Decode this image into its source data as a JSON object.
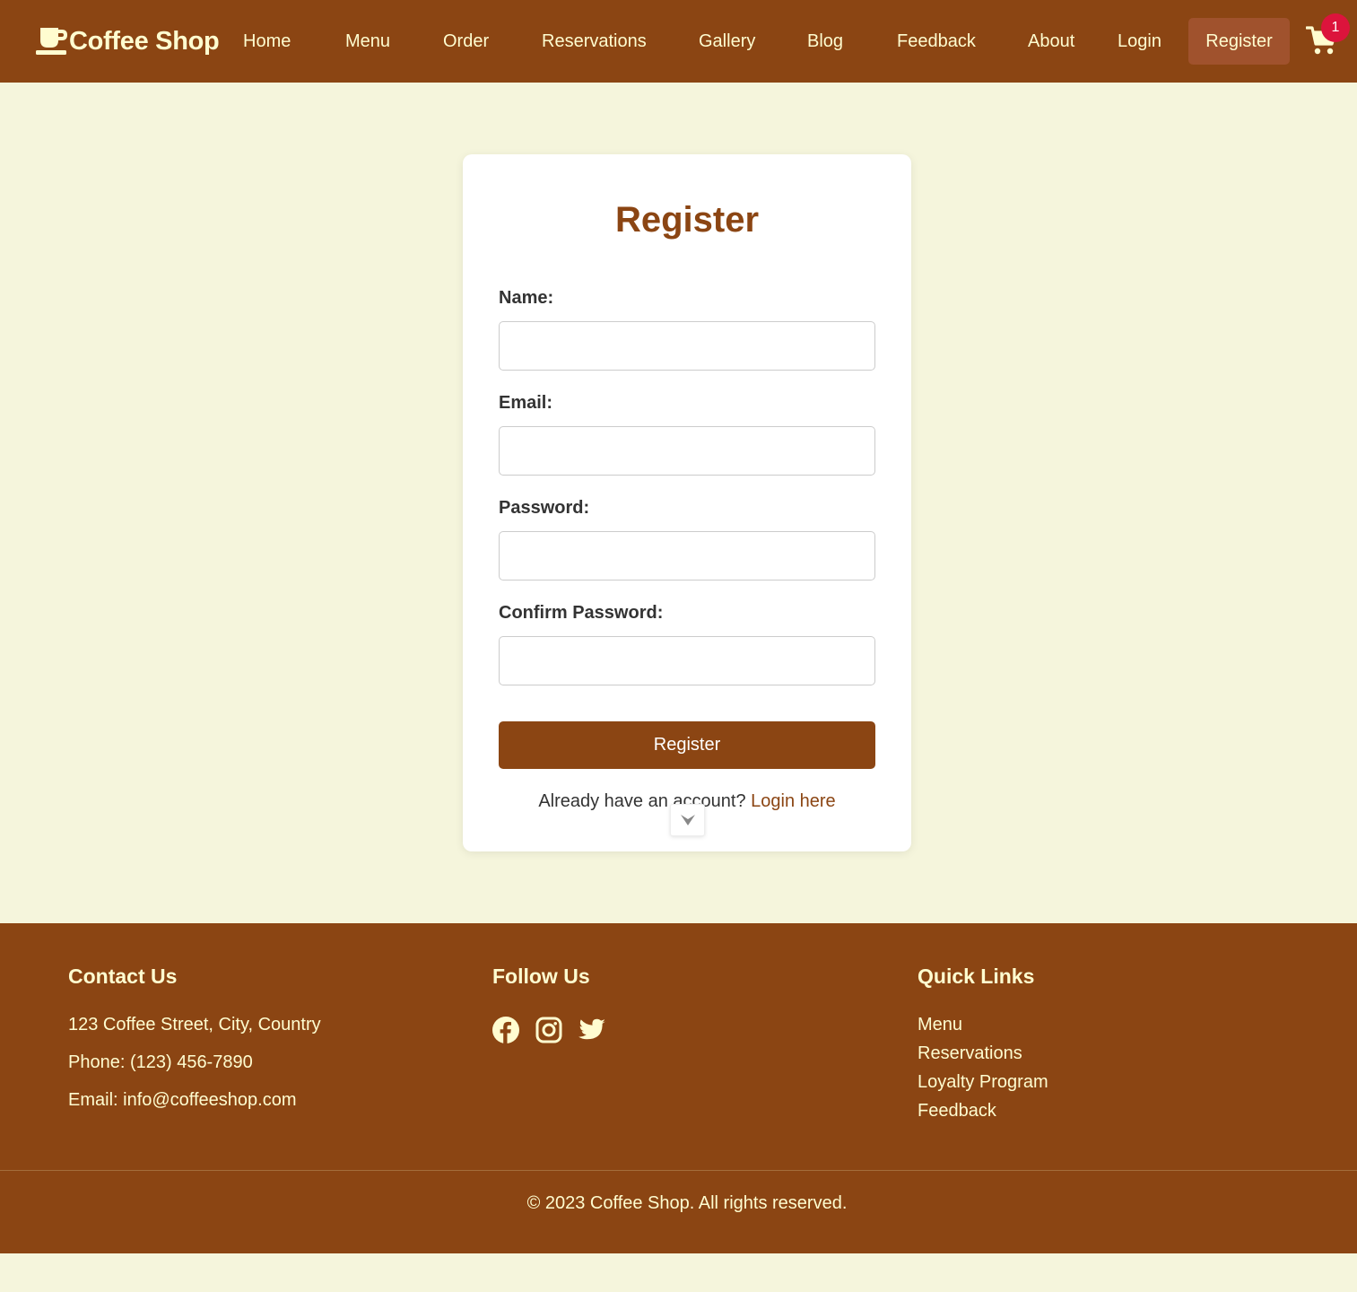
{
  "header": {
    "brand": {
      "icon": "coffee-cup-icon",
      "name": "Coffee Shop"
    },
    "nav": {
      "home": "Home",
      "menu": "Menu",
      "order": "Order",
      "reservations": "Reservations",
      "gallery": "Gallery",
      "blog": "Blog",
      "feedback": "Feedback",
      "about": "About",
      "login": "Login",
      "register": "Register"
    },
    "cart": {
      "icon": "shopping-cart-icon",
      "count": "1"
    }
  },
  "register_form": {
    "title": "Register",
    "fields": {
      "name": {
        "label": "Name:",
        "value": ""
      },
      "email": {
        "label": "Email:",
        "value": ""
      },
      "password": {
        "label": "Password:",
        "value": ""
      },
      "confirm_password": {
        "label": "Confirm Password:",
        "value": ""
      }
    },
    "submit_label": "Register",
    "login_prompt": "Already have an account?",
    "login_link": "Login here"
  },
  "footer": {
    "contact": {
      "heading": "Contact Us",
      "address": "123 Coffee Street, City, Country",
      "phone": "Phone: (123) 456-7890",
      "email": "Email: info@coffeeshop.com"
    },
    "follow": {
      "heading": "Follow Us",
      "icons": [
        "facebook-icon",
        "instagram-icon",
        "twitter-icon"
      ]
    },
    "quick_links": {
      "heading": "Quick Links",
      "items": [
        "Menu",
        "Reservations",
        "Loyalty Program",
        "Feedback"
      ]
    },
    "copyright": "© 2023 Coffee Shop. All rights reserved."
  },
  "colors": {
    "header_bg": "#8b4513",
    "page_bg": "#f5f5dc",
    "cream_text": "#fffdd0",
    "register_nav_bg": "#a0522d",
    "badge": "#dc143c",
    "title": "#8b4513"
  }
}
